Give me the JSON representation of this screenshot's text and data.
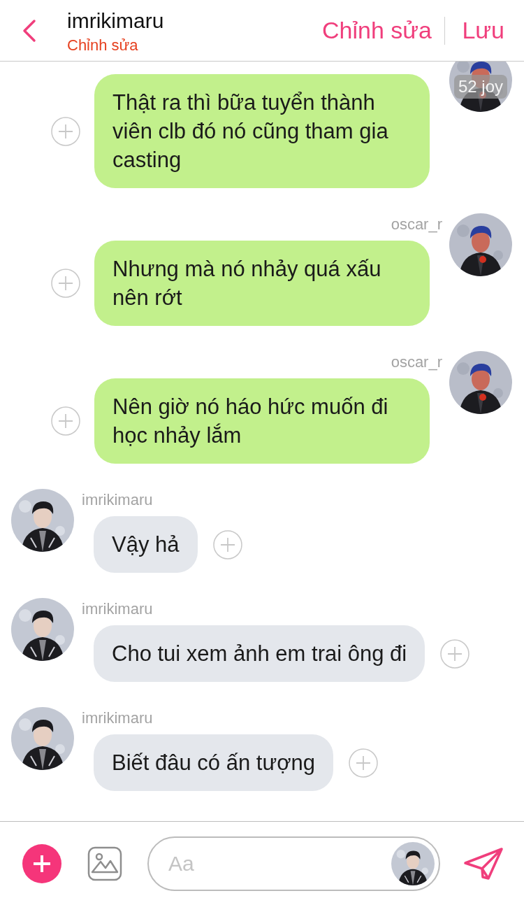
{
  "header": {
    "title": "imrikimaru",
    "subtitle": "Chỉnh sửa",
    "actions": [
      "Chỉnh sửa",
      "Lưu"
    ]
  },
  "messages": [
    {
      "kind": "sent",
      "text": "Thật ra thì bữa tuyển thành viên clb đó nó cũng tham gia casting",
      "badge": "52 joy"
    },
    {
      "kind": "sent",
      "sender": "oscar_r",
      "text": "Nhưng mà nó nhảy quá xấu nên rớt"
    },
    {
      "kind": "sent",
      "sender": "oscar_r",
      "text": "Nên giờ nó háo hức muốn đi học nhảy lắm"
    },
    {
      "kind": "received",
      "sender": "imrikimaru",
      "text": "Vậy hả"
    },
    {
      "kind": "received",
      "sender": "imrikimaru",
      "text": "Cho tui xem ảnh em trai ông đi"
    },
    {
      "kind": "received",
      "sender": "imrikimaru",
      "text": "Biết đâu có ấn tượng"
    }
  ],
  "composer": {
    "placeholder": "Aa"
  }
}
